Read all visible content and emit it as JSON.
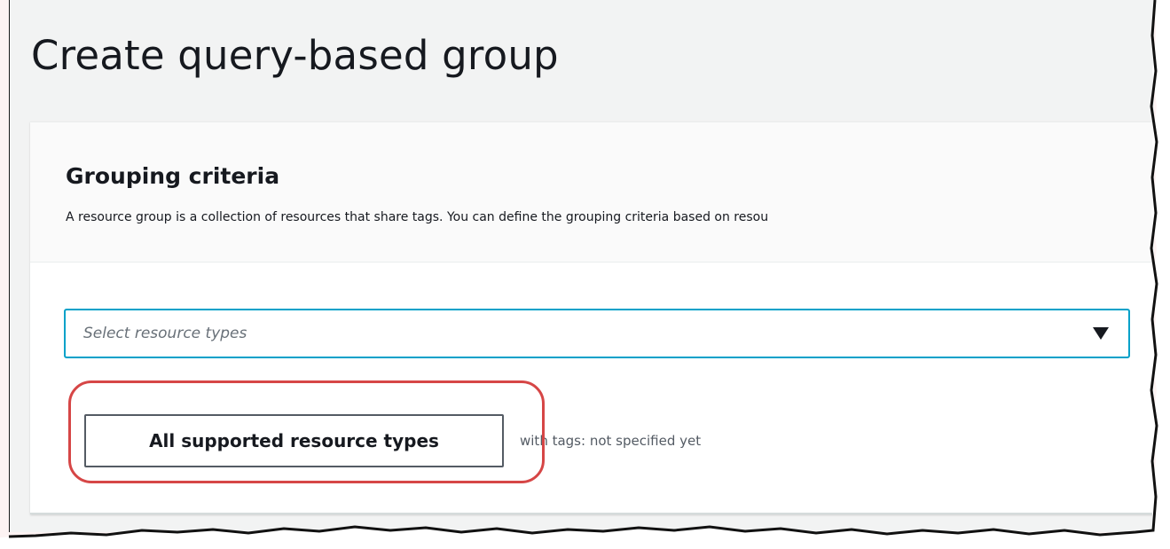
{
  "page": {
    "title": "Create query-based group"
  },
  "grouping_criteria": {
    "heading": "Grouping criteria",
    "description": "A resource group is a collection of resources that share tags. You can define the grouping criteria based on resou"
  },
  "resource_type_select": {
    "placeholder": "Select resource types",
    "icon": "caret-down-icon"
  },
  "all_types_button": {
    "label": "All supported resource types"
  },
  "tags_status": {
    "text": "with tags: not specified yet"
  },
  "colors": {
    "accent": "#00a1c9",
    "highlight": "#d64646",
    "page_background": "#f2f3f3",
    "text": "#16191f"
  }
}
